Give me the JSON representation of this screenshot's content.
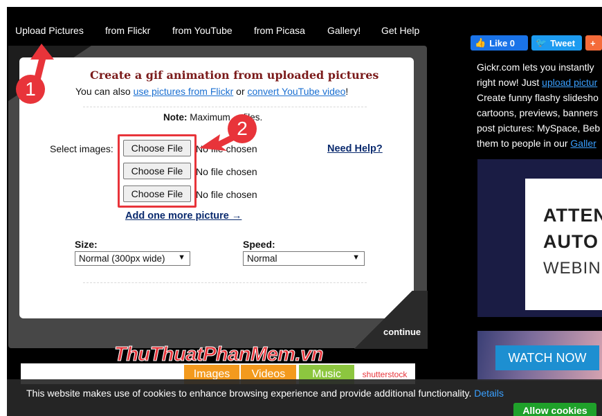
{
  "nav": {
    "items": [
      "Upload Pictures",
      "from Flickr",
      "from YouTube",
      "from Picasa",
      "Gallery!",
      "Get Help"
    ]
  },
  "form": {
    "title": "Create a gif animation from uploaded pictures",
    "sub_prefix": "You can also ",
    "sub_link1": "use pictures from Flickr",
    "sub_mid": " or ",
    "sub_link2": "convert YouTube video",
    "sub_suffix": "!",
    "note_label": "Note:",
    "note_text": " Maximum ... files.",
    "select_label": "Select images:",
    "choose_file_label": "Choose File",
    "no_file_text": "No file chosen",
    "need_help": "Need Help?",
    "add_more": "Add one more picture →",
    "size_label": "Size:",
    "size_value": "Normal (300px wide)",
    "speed_label": "Speed:",
    "speed_value": "Normal",
    "continue_label": "continue"
  },
  "annotations": {
    "badge1": "1",
    "badge2": "2",
    "accent_color": "#e8343a"
  },
  "share": {
    "like": "Like 0",
    "tweet": "Tweet",
    "plus": "+"
  },
  "right_text": {
    "line1": "Gickr.com lets you instantly",
    "line2_prefix": "right now! Just ",
    "line2_link": "upload pictur",
    "line3": "Create funny flashy slidesho",
    "line4": "cartoons, previews, banners",
    "line5": "post pictures: MySpace, Beb",
    "line6_prefix": "them to people in our ",
    "line6_link": "Galler"
  },
  "ad": {
    "line1": "ATTEN",
    "line2": "AUTO",
    "line3": "WEBIN",
    "watch_now": "WATCH NOW"
  },
  "ad_strip": {
    "tabs": [
      "Images",
      "Videos",
      "Music"
    ],
    "brand": "shutterstock"
  },
  "watermark": "ThuThuatPhanMem.vn",
  "cookie": {
    "text": "This website makes use of cookies to enhance browsing experience and provide additional functionality.",
    "details": "Details",
    "allow": "Allow cookies"
  }
}
